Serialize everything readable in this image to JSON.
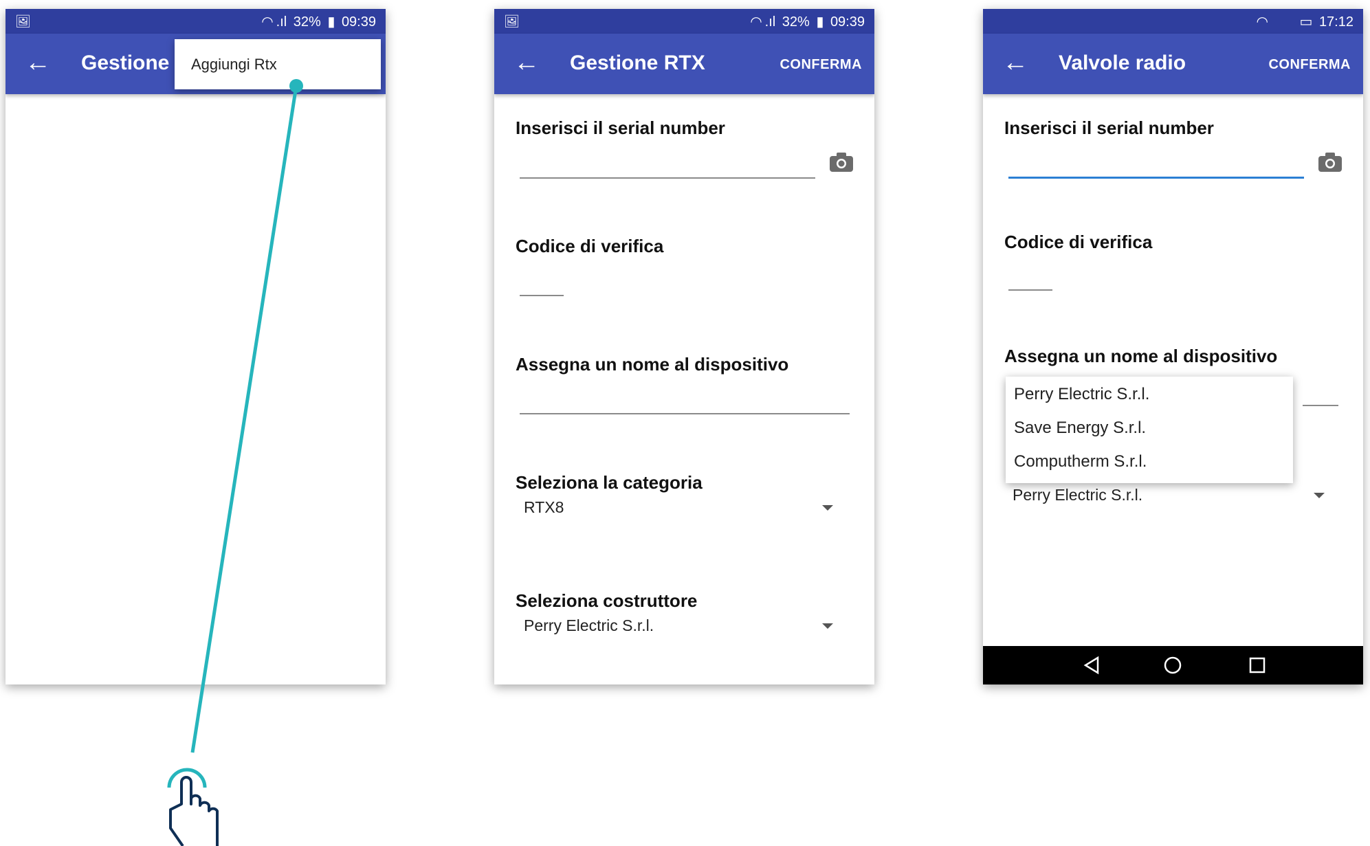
{
  "colors": {
    "primary": "#3f51b5",
    "status_bar": "#2f3e9e",
    "accent_line": "#2b7fd4",
    "tap_indicator": "#26b5bc",
    "hand_outline": "#0f2f55"
  },
  "phone1": {
    "status": {
      "battery": "32%",
      "time": "09:39",
      "image_icon": "image-icon",
      "wifi_icon": "wifi-icon",
      "signal_icon": "signal-icon",
      "battery_icon": "battery-icon"
    },
    "appbar": {
      "back_icon": "arrow-left-icon",
      "title": "Gestione RTX"
    },
    "menu": {
      "item": "Aggiungi Rtx"
    }
  },
  "phone2": {
    "status": {
      "battery": "32%",
      "time": "09:39"
    },
    "appbar": {
      "title": "Gestione RTX",
      "confirm": "CONFERMA"
    },
    "fields": {
      "serial_label": "Inserisci il serial number",
      "verify_label": "Codice di verifica",
      "name_label": "Assegna un nome al dispositivo",
      "category_label": "Seleziona la categoria",
      "category_value": "RTX8",
      "maker_label": "Seleziona costruttore",
      "maker_value": "Perry Electric S.r.l."
    }
  },
  "phone3": {
    "status": {
      "time": "17:12"
    },
    "appbar": {
      "title": "Valvole radio",
      "confirm": "CONFERMA"
    },
    "fields": {
      "serial_label": "Inserisci il serial number",
      "verify_label": "Codice di verifica",
      "name_label": "Assegna un nome al dispositivo",
      "maker_value": "Perry Electric S.r.l."
    },
    "dropdown": [
      "Perry Electric S.r.l.",
      "Save Energy S.r.l.",
      "Computherm S.r.l."
    ],
    "navbar": {
      "back": "triangle-back-icon",
      "home": "circle-home-icon",
      "recents": "square-recents-icon"
    }
  }
}
